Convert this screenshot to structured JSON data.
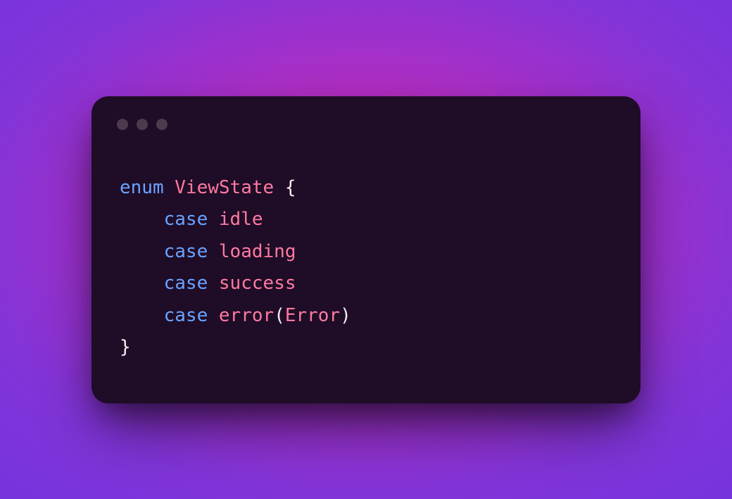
{
  "colors": {
    "keyword": "#6aa3ff",
    "type": "#ff7aa0",
    "punct": "#f6eff2",
    "window_bg": "#1f0c27",
    "traffic_dot": "#4d3a4f"
  },
  "code": {
    "kw_enum": "enum",
    "space": " ",
    "type_ViewState": "ViewState",
    "brace_open": " {",
    "indent": "    ",
    "kw_case1": "case",
    "val_idle": "idle",
    "kw_case2": "case",
    "val_loading": "loading",
    "kw_case3": "case",
    "val_success": "success",
    "kw_case4": "case",
    "val_error": "error",
    "paren_open": "(",
    "type_Error": "Error",
    "paren_close": ")",
    "brace_close": "}"
  }
}
